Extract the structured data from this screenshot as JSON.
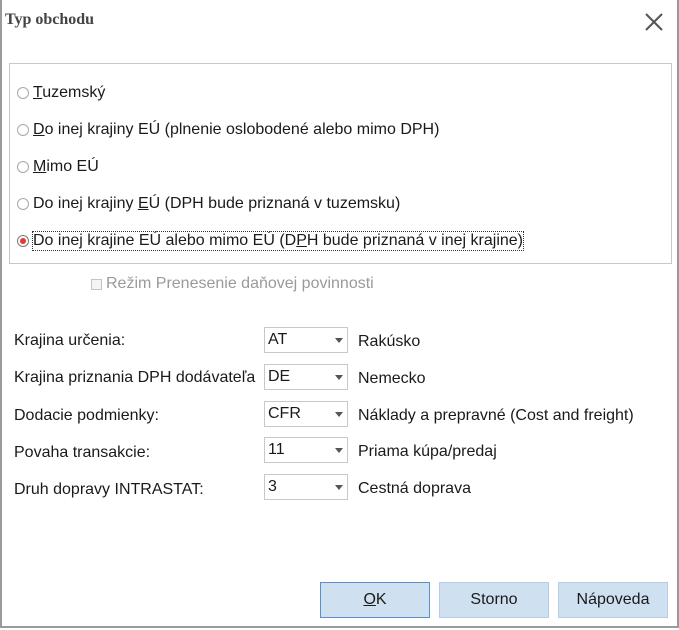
{
  "dialog": {
    "title": "Typ obchodu"
  },
  "trade_types": [
    {
      "pre": "",
      "ul": "T",
      "post": "uzemský",
      "selected": false
    },
    {
      "pre": "",
      "ul": "D",
      "post": "o inej krajiny EÚ (plnenie oslobodené alebo mimo DPH)",
      "selected": false
    },
    {
      "pre": "",
      "ul": "M",
      "post": "imo EÚ",
      "selected": false
    },
    {
      "pre": "Do inej krajiny ",
      "ul": "E",
      "post": "Ú (DPH bude priznaná v tuzemsku)",
      "selected": false
    },
    {
      "pre": "Do inej krajine EÚ alebo mimo EÚ (D",
      "ul": "P",
      "post": "H bude priznaná v inej krajine)",
      "selected": true
    }
  ],
  "reverse_charge": {
    "label": "Režim Prenesenie daňovej povinnosti",
    "checked": false,
    "enabled": false
  },
  "fields": [
    {
      "label": "Krajina určenia:",
      "value": "AT",
      "desc": "Rakúsko"
    },
    {
      "label": "Krajina priznania DPH dodávateľa",
      "value": "DE",
      "desc": "Nemecko"
    },
    {
      "label": "Dodacie podmienky:",
      "value": "CFR",
      "desc": "Náklady a prepravné  (Cost and freight)"
    },
    {
      "label": "Povaha transakcie:",
      "value": "11",
      "desc": "Priama kúpa/predaj"
    },
    {
      "label": "Druh dopravy INTRASTAT:",
      "value": "3",
      "desc": "Cestná doprava"
    }
  ],
  "buttons": {
    "ok": {
      "ul": "O",
      "post": "K"
    },
    "cancel": "Storno",
    "help": "Nápoveda"
  },
  "colors": {
    "button_bg": "#cfe0f1",
    "radio_selected": "#e53935"
  }
}
